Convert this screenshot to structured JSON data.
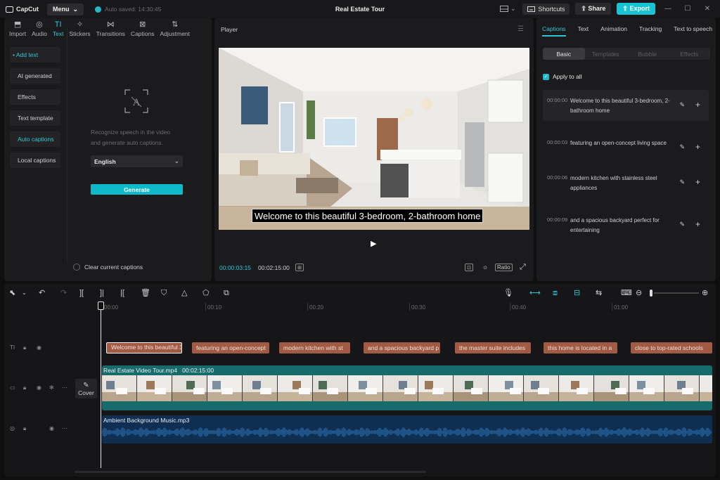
{
  "app": {
    "logo_text": "CapCut",
    "menu_label": "Menu",
    "autosave_text": "Auto saved: 14:30:45",
    "project_title": "Real Estate Tour",
    "shortcuts_label": "Shortcuts",
    "share_label": "Share",
    "export_label": "Export"
  },
  "left_tabs": [
    {
      "label": "Import",
      "icon": "import-icon"
    },
    {
      "label": "Audio",
      "icon": "audio-icon"
    },
    {
      "label": "Text",
      "icon": "text-icon"
    },
    {
      "label": "Stickers",
      "icon": "sticker-icon"
    },
    {
      "label": "Transitions",
      "icon": "transition-icon"
    },
    {
      "label": "Captions",
      "icon": "captions-icon"
    },
    {
      "label": "Adjustment",
      "icon": "adjustment-icon"
    }
  ],
  "sidebar": [
    {
      "label": "• Add text"
    },
    {
      "label": "AI generated"
    },
    {
      "label": "Effects"
    },
    {
      "label": "Text template"
    },
    {
      "label": "Auto captions"
    },
    {
      "label": "Local captions"
    }
  ],
  "auto_captions": {
    "description_line1": "Recognize speech in the video",
    "description_line2": "and generate auto captions.",
    "language": "English",
    "generate_label": "Generate",
    "clear_label": "Clear current captions"
  },
  "player": {
    "title": "Player",
    "subtitle_text": "Welcome to this beautiful 3-bedroom, 2-bathroom home",
    "current_time": "00:00:03:15",
    "total_time": "00:02:15:00",
    "ratio_label": "Ratio"
  },
  "right_tabs": [
    "Captions",
    "Text",
    "Animation",
    "Tracking",
    "Text to speech"
  ],
  "right_subtabs": [
    "Basic",
    "Templates",
    "Bubble",
    "Effects"
  ],
  "apply_all_label": "Apply to all",
  "captions": [
    {
      "time": "00:00:00",
      "text": "Welcome to this beautiful 3-bedroom, 2-bathroom home"
    },
    {
      "time": "00:00:03",
      "text": "featuring an open-concept living space"
    },
    {
      "time": "00:00:06",
      "text": "modern kitchen with stainless steel appliances"
    },
    {
      "time": "00:00:09",
      "text": "and a spacious backyard perfect for entertaining"
    }
  ],
  "timeline": {
    "ruler": [
      "00:00",
      "00:10",
      "00:20",
      "00:30",
      "00:40",
      "01:00"
    ],
    "text_clips": [
      "Welcome to this beautiful 3",
      "featuring an open-concept",
      "modern kitchen with st",
      "and a spacious backyard p",
      "the master suite includes",
      "this home is located in a",
      "close to top-rated schools"
    ],
    "cover_label": "Cover",
    "video_clip": "Real Estate Video Tour.mp4",
    "video_duration": "00:02:15:00",
    "audio_clip": "Ambient Background Music.mp3"
  },
  "colors": {
    "accent": "#18c4d4",
    "text_clip": "#a15a43",
    "video_track": "#176b6b",
    "audio_track": "#0f2f52"
  }
}
